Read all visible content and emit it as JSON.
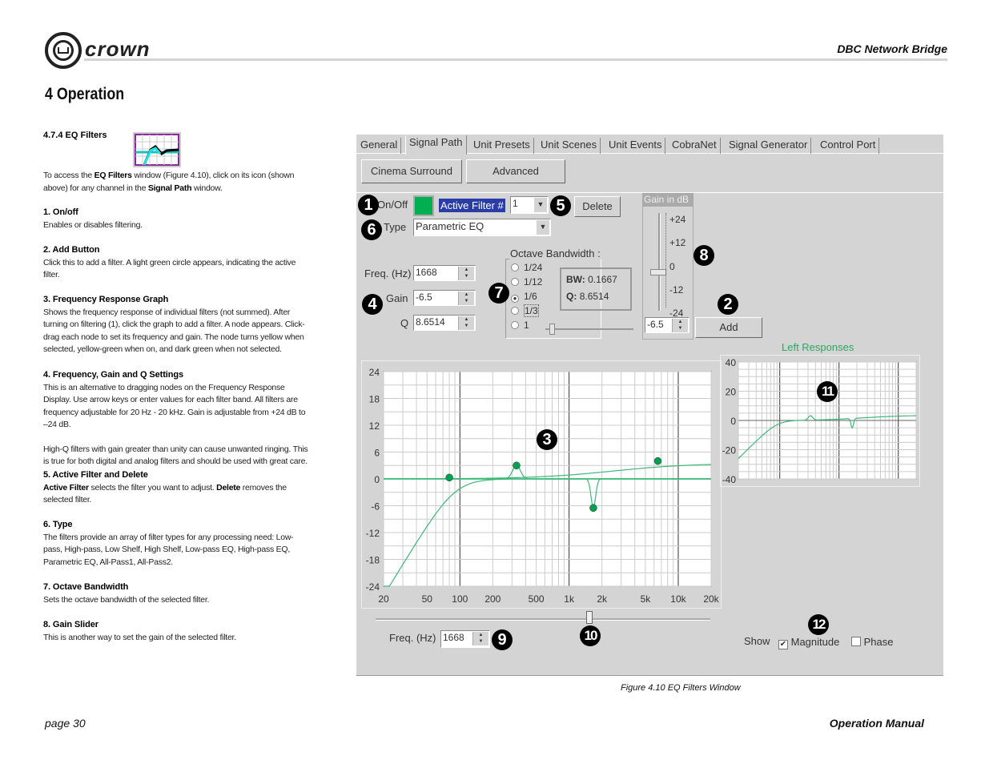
{
  "header": {
    "brand": "crown",
    "product": "DBC Network Bridge",
    "chapter": "4 Operation"
  },
  "section": {
    "title": "4.7.4 EQ Filters",
    "icon": "eq-filters-icon",
    "intro": [
      "To access the ",
      "EQ Filters",
      " window (Figure 4.10), click on its icon (shown above) for any channel in the ",
      "Signal Path",
      " window."
    ],
    "items": [
      {
        "title": "1. On/off",
        "text": "Enables or disables filtering."
      },
      {
        "title": "2. Add Button",
        "text": "Click this to add a filter. A light green circle appears, indicating the active filter."
      },
      {
        "title": "3. Frequency Response Graph",
        "text": "Shows the frequency response of individual filters (not summed). After turning on filtering (1), click the graph to add a filter. A node appears. Click-drag each node to set its frequency and gain. The node turns yellow when selected, yellow-green when on, and dark green when not selected."
      },
      {
        "title": "4. Frequency, Gain and Q Settings",
        "text": "This is an alternative to dragging nodes on the Frequency Response Display. Use arrow keys or enter values for each filter band. All filters are frequency adjustable for 20 Hz - 20 kHz. Gain is adjustable from +24 dB to –24 dB.",
        "text2": "High-Q filters with gain greater than unity can cause unwanted ringing. This is true for both digital and analog filters and should be used with great care."
      },
      {
        "title": "5. Active Filter and Delete",
        "b1": "Active Filter",
        "m1": " selects the filter you want to adjust. ",
        "b2": "Delete",
        "m2": " removes the selected filter."
      },
      {
        "title": "6. Type",
        "text": "The filters provide an array of filter types for any processing need: Low-pass, High-pass, Low Shelf, High Shelf, Low-pass EQ, High-pass EQ, Parametric EQ, All-Pass1, All-Pass2."
      },
      {
        "title": "7. Octave Bandwidth",
        "text": "Sets the octave bandwidth of the selected filter."
      },
      {
        "title": "8. Gain Slider",
        "text": "This is another way to set the gain of the selected filter."
      }
    ]
  },
  "window": {
    "tabs": [
      "General",
      "Signal Path",
      "Unit Presets",
      "Unit Scenes",
      "Unit Events",
      "CobraNet",
      "Signal Generator",
      "Control Port"
    ],
    "active_tab": "Signal Path",
    "sub_buttons": [
      "Cinema Surround",
      "Advanced"
    ],
    "onoff_label": "On/Off",
    "onoff_color": "#00b050",
    "active_filter_label": "Active Filter #",
    "active_filter_value": "1",
    "delete_label": "Delete",
    "type_label": "Type",
    "type_value": "Parametric EQ",
    "freq_label": "Freq. (Hz)",
    "freq_value": "1668",
    "gain_label": "Gain",
    "gain_value": "-6.5",
    "q_label": "Q",
    "q_value": "8.6514",
    "octave": {
      "title": "Octave Bandwidth :",
      "options": [
        "1/24",
        "1/12",
        "1/6",
        "1/3",
        "1"
      ],
      "selected": "1/6",
      "bw_label": "BW:",
      "bw_value": "0.1667",
      "q_label": "Q:",
      "q_value": "8.6514"
    },
    "gain_slider": {
      "title": "Gain in dB",
      "ticks": [
        "+24",
        "+12",
        "0",
        "-12",
        "-24"
      ],
      "value": "-6.5"
    },
    "add_label": "Add",
    "main_graph": {
      "y_ticks": [
        "24",
        "18",
        "12",
        "6",
        "0",
        "-6",
        "-12",
        "-18",
        "-24"
      ],
      "x_ticks": [
        "20",
        "50",
        "100",
        "200",
        "500",
        "1k",
        "2k",
        "5k",
        "10k",
        "20k"
      ],
      "ylim": [
        -24,
        24
      ],
      "xlim": [
        20,
        20000
      ],
      "curve_color": "#3cb878",
      "nodes": [
        {
          "freq": 80,
          "gain": 0.3
        },
        {
          "freq": 330,
          "gain": 3
        },
        {
          "freq": 1668,
          "gain": -6.5
        },
        {
          "freq": 6500,
          "gain": 4
        }
      ]
    },
    "mini_graph": {
      "title": "Left Responses",
      "y_ticks": [
        "40",
        "20",
        "0",
        "-20",
        "-40"
      ],
      "ylim": [
        -40,
        40
      ]
    },
    "bottom_freq_label": "Freq. (Hz)",
    "bottom_freq_value": "1668",
    "show_label": "Show",
    "magnitude_label": "Magnitude",
    "magnitude_checked": true,
    "phase_label": "Phase",
    "phase_checked": false,
    "badges": [
      "1",
      "2",
      "3",
      "4",
      "5",
      "6",
      "7",
      "8",
      "9",
      "10",
      "11",
      "12"
    ]
  },
  "caption": "Figure 4.10  EQ Filters Window",
  "footer": {
    "page": "page 30",
    "manual": "Operation Manual"
  }
}
